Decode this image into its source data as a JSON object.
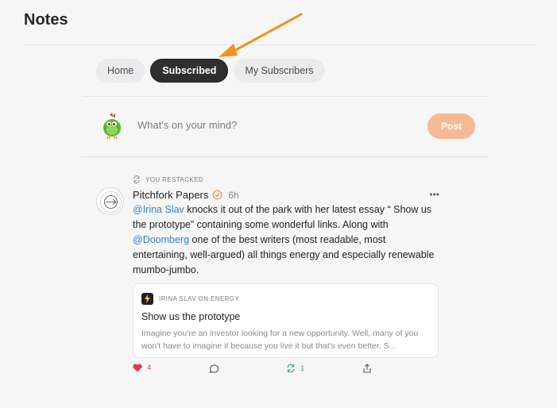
{
  "page": {
    "title": "Notes"
  },
  "tabs": [
    {
      "label": "Home",
      "active": false
    },
    {
      "label": "Subscribed",
      "active": true
    },
    {
      "label": "My Subscribers",
      "active": false
    }
  ],
  "composer": {
    "placeholder": "What's on your mind?",
    "post_label": "Post",
    "avatar_icon": "green-bird-avatar"
  },
  "note": {
    "restack_label": "YOU RESTACKED",
    "author": "Pitchfork Papers",
    "verified_icon": "check-badge-icon",
    "time": "6h",
    "body": {
      "mention1": "@Irina Slav",
      "text1": " knocks it out of the park with her latest essay “ Show us the prototype” containing some wonderful links. Along with ",
      "mention2": "@Doomberg",
      "text2": " one of the best writers (most readable, most entertaining, well-argued) all things energy and especially renewable mumbo-jumbo."
    },
    "embed": {
      "publication": "IRINA SLAV ON ENERGY",
      "title": "Show us the prototype",
      "excerpt": "Imagine you're an investor looking for a new opportunity. Well, many of you won't have to imagine it because you live it but that's even better. S..."
    },
    "actions": {
      "likes": "4",
      "restacks": "1"
    }
  },
  "colors": {
    "accent": "#f7b894",
    "link": "#2f83c9",
    "like": "#e0394f",
    "restack": "#35b56a",
    "arrow": "#f4921d",
    "verified": "#f08a3c"
  }
}
